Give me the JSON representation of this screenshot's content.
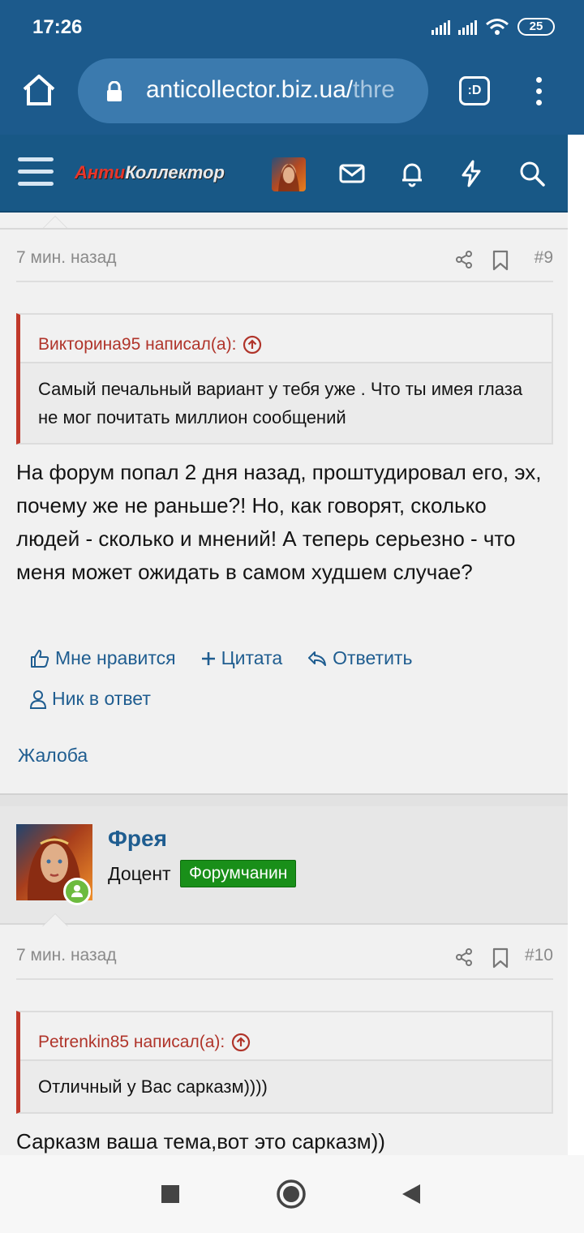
{
  "status_bar": {
    "time": "17:26",
    "battery": "25"
  },
  "browser": {
    "url_main": "anticollector.biz.ua/",
    "url_fade": "thre",
    "tabs_label": ":D"
  },
  "forum": {
    "logo_part1": "Анти",
    "logo_part2": "Коллектор"
  },
  "post9": {
    "time": "7 мин. назад",
    "number": "#9",
    "quote_author": "Викторина95 написал(а):",
    "quote_text": "Самый печальный вариант у тебя уже . Что ты имея глаза не мог почитать миллион сообщений",
    "body": "На форум попал 2 дня назад, проштудировал его, эх, почему же не раньше?! Но, как говорят, сколько людей - сколько и мнений! А теперь серьезно - что меня может ожидать в самом худшем случае?",
    "actions": {
      "like": "Мне нравится",
      "quote": "Цитата",
      "reply": "Ответить",
      "mention": "Ник в ответ"
    },
    "report": "Жалоба"
  },
  "post10": {
    "user_name": "Фрея",
    "user_title": "Доцент",
    "user_badge": "Форумчанин",
    "time": "7 мин. назад",
    "number": "#10",
    "quote_author": "Petrenkin85 написал(а):",
    "quote_text": "Отличный у Вас сарказм))))",
    "body": "Сарказм ваша тема,вот это сарказм))"
  },
  "colors": {
    "chrome_blue": "#1c5a8c",
    "forum_header": "#185886",
    "quote_accent": "#c0392b",
    "link_blue": "#1f5d90",
    "badge_green": "#198f19"
  }
}
